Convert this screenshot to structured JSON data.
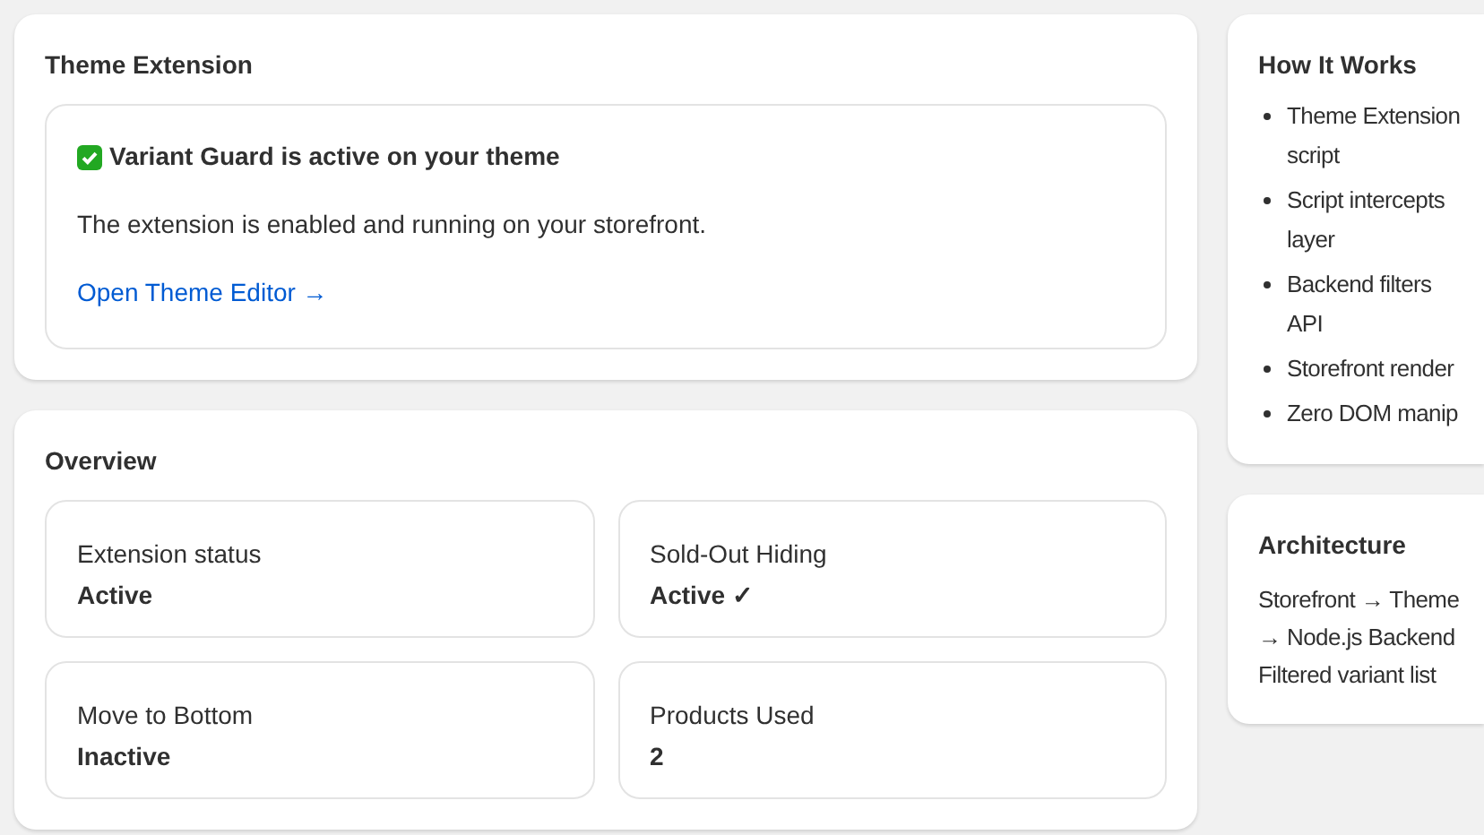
{
  "theme_extension": {
    "title": "Theme Extension",
    "status_heading": "Variant Guard is active on your theme",
    "description": "The extension is enabled and running on your storefront.",
    "link": "Open Theme Editor →"
  },
  "overview": {
    "title": "Overview",
    "stats": [
      {
        "label": "Extension status",
        "value": "Active"
      },
      {
        "label": "Sold-Out Hiding",
        "value": "Active ✓"
      },
      {
        "label": "Move to Bottom",
        "value": "Inactive"
      },
      {
        "label": "Products Used",
        "value": "2"
      }
    ]
  },
  "how_it_works": {
    "title": "How It Works",
    "items": [
      {
        "lines": [
          "Theme Extension",
          "script"
        ]
      },
      {
        "lines": [
          "Script intercepts",
          "layer"
        ]
      },
      {
        "lines": [
          "Backend filters",
          "API"
        ]
      },
      {
        "lines": [
          "Storefront render"
        ]
      },
      {
        "lines": [
          "Zero DOM manip"
        ]
      }
    ]
  },
  "architecture": {
    "title": "Architecture",
    "lines": [
      "Storefront → Theme",
      "→ Node.js Backend",
      "Filtered variant list"
    ]
  }
}
